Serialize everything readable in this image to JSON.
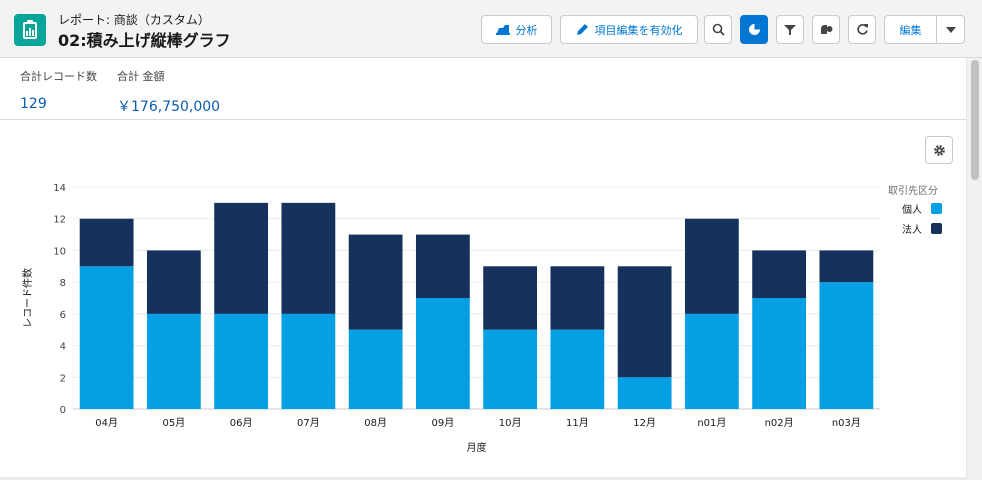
{
  "header": {
    "subtitle": "レポート: 商談（カスタム）",
    "title": "02:積み上げ縦棒グラフ",
    "analyze_label": "分析",
    "enable_edit_label": "項目編集を有効化",
    "edit_label": "編集"
  },
  "summary": {
    "total_records_label": "合計レコード数",
    "total_records_value": "129",
    "total_amount_label": "合計 金額",
    "total_amount_value": "￥176,750,000"
  },
  "colors": {
    "individual": "#04a0e3",
    "corporate": "#16325c",
    "accent": "#0176d3"
  },
  "chart_data": {
    "type": "bar",
    "stacked": true,
    "categories": [
      "04月",
      "05月",
      "06月",
      "07月",
      "08月",
      "09月",
      "10月",
      "11月",
      "12月",
      "n01月",
      "n02月",
      "n03月"
    ],
    "series": [
      {
        "name": "個人",
        "values": [
          9,
          6,
          6,
          6,
          5,
          7,
          5,
          5,
          2,
          6,
          7,
          8
        ]
      },
      {
        "name": "法人",
        "values": [
          3,
          4,
          7,
          7,
          6,
          4,
          4,
          4,
          7,
          6,
          3,
          2
        ]
      }
    ],
    "xlabel": "月度",
    "ylabel": "レコード件数",
    "ylim": [
      0,
      14
    ],
    "yticks": [
      0,
      2,
      4,
      6,
      8,
      10,
      12,
      14
    ],
    "legend_title": "取引先区分",
    "legend_position": "right",
    "grid": true
  }
}
